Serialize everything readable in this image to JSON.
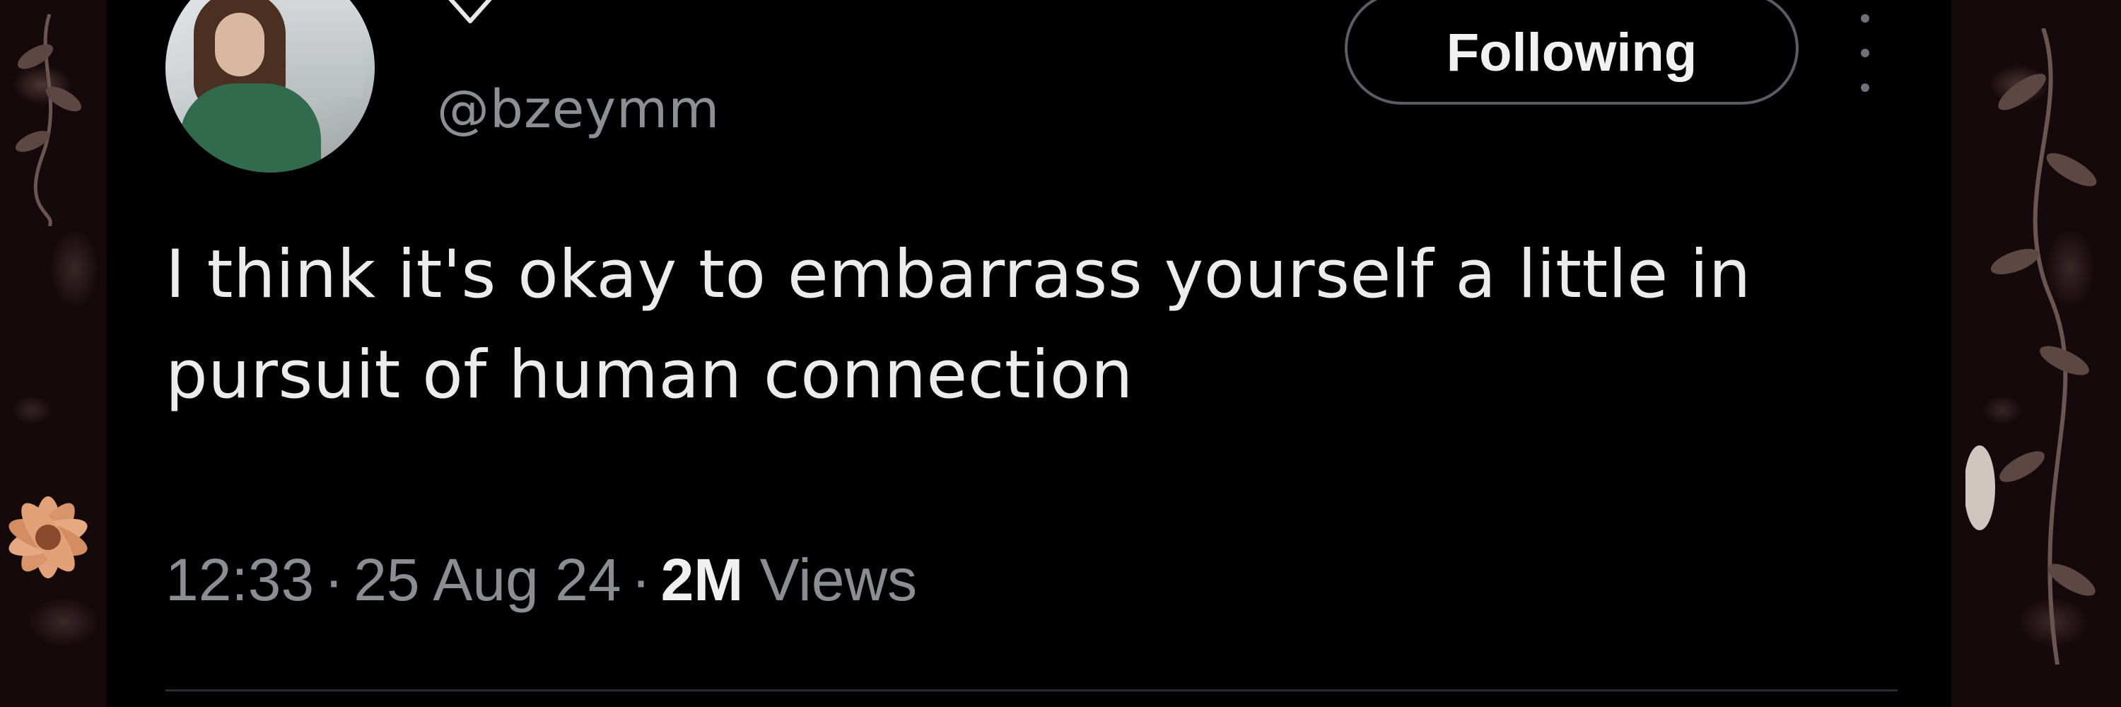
{
  "tweet": {
    "handle": "@bzeymm",
    "follow_label": "Following",
    "text": "I think it's okay to embarrass yourself a little in pursuit of human connection",
    "time": "12:33",
    "date": "25 Aug 24",
    "views_count": "2M",
    "views_label": "Views",
    "separator": "·"
  },
  "icons": {
    "verified": "verified-badge-icon",
    "more": "more-options-icon"
  },
  "colors": {
    "card_background": "#000000",
    "text_primary": "#ececec",
    "text_secondary": "#8a8d91",
    "button_border": "#5a5d61"
  }
}
